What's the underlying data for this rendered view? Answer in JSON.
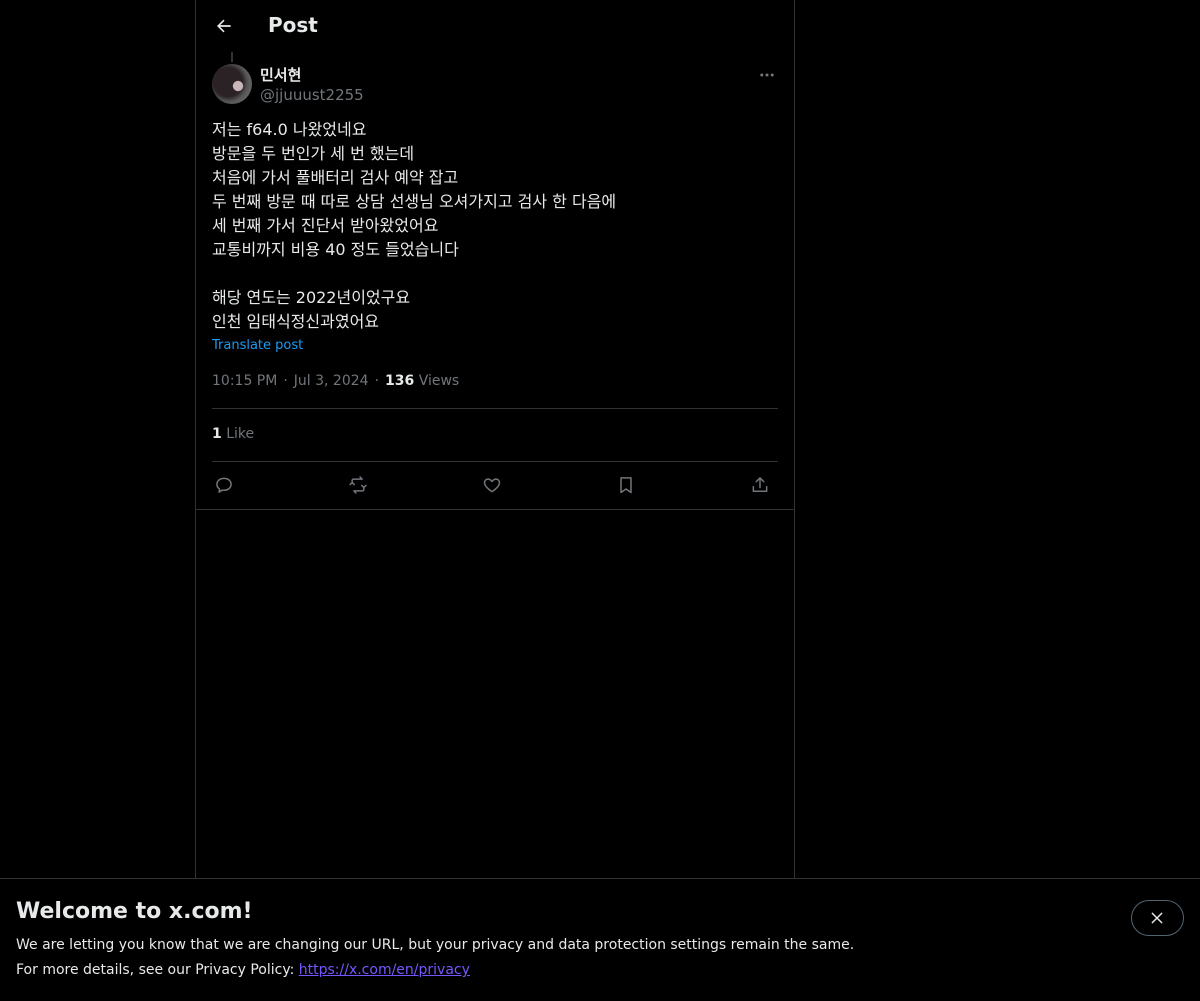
{
  "header": {
    "title": "Post",
    "back_icon": "arrow-left-icon"
  },
  "author": {
    "name": "민서현",
    "handle": "@jjuuust2255"
  },
  "post": {
    "lines": [
      "저는 f64.0 나왔었네요",
      "방문을 두 번인가 세 번 했는데",
      "처음에 가서 풀배터리 검사 예약 잡고",
      "두 번째 방문 때 따로 상담 선생님 오셔가지고 검사 한 다음에",
      "세 번째 가서 진단서 받아왔었어요",
      "교통비까지 비용 40 정도 들었습니다",
      "",
      "해당 연도는 2022년이었구요",
      "인천 임태식정신과였어요"
    ],
    "translate_label": "Translate post",
    "time": "10:15 PM",
    "date": "Jul 3, 2024",
    "views_count": "136",
    "views_label": "Views",
    "separator": "·"
  },
  "engagement": {
    "likes_count": "1",
    "likes_label": "Like"
  },
  "actions": [
    {
      "name": "reply",
      "icon": "reply-icon"
    },
    {
      "name": "repost",
      "icon": "repost-icon"
    },
    {
      "name": "like",
      "icon": "heart-icon"
    },
    {
      "name": "bookmark",
      "icon": "bookmark-icon"
    },
    {
      "name": "share",
      "icon": "share-icon"
    }
  ],
  "banner": {
    "title": "Welcome to x.com!",
    "line1": "We are letting you know that we are changing our URL, but your privacy and data protection settings remain the same.",
    "line2_prefix": "For more details, see our Privacy Policy: ",
    "link": "https://x.com/en/privacy",
    "close_icon": "close-icon"
  },
  "colors": {
    "background": "#000000",
    "text": "#e7e9ea",
    "muted": "#71767b",
    "accent": "#1d9bf0",
    "link": "#7856ff",
    "border": "#2f3336"
  }
}
